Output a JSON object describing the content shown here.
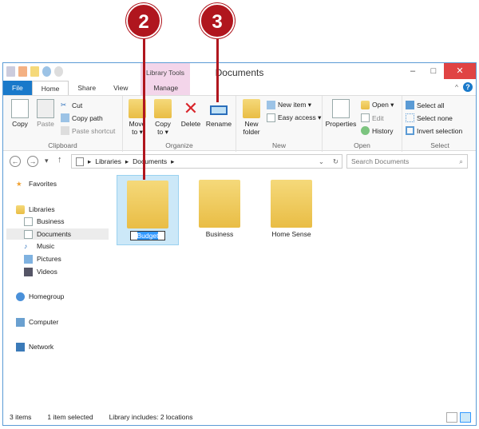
{
  "callouts": [
    "2",
    "3"
  ],
  "title": {
    "window_title": "Documents",
    "contextual_tab": "Library Tools"
  },
  "tabs": [
    "File",
    "Home",
    "Share",
    "View",
    "Manage"
  ],
  "ribbon": {
    "clipboard": {
      "label": "Clipboard",
      "copy": "Copy",
      "paste": "Paste",
      "cut": "Cut",
      "copy_path": "Copy path",
      "paste_shortcut": "Paste shortcut"
    },
    "organize": {
      "label": "Organize",
      "move_to": "Move to ▾",
      "copy_to": "Copy to ▾",
      "delete": "Delete",
      "rename": "Rename"
    },
    "new": {
      "label": "New",
      "new_folder": "New folder",
      "new_item": "New item ▾",
      "easy_access": "Easy access ▾"
    },
    "open": {
      "label": "Open",
      "properties": "Properties",
      "open": "Open ▾",
      "edit": "Edit",
      "history": "History"
    },
    "select": {
      "label": "Select",
      "select_all": "Select all",
      "select_none": "Select none",
      "invert": "Invert selection"
    }
  },
  "address": {
    "crumbs": [
      "Libraries",
      "Documents"
    ],
    "search_placeholder": "Search Documents"
  },
  "sidebar": {
    "favorites": "Favorites",
    "libraries": "Libraries",
    "library_items": [
      "Business",
      "Documents",
      "Music",
      "Pictures",
      "Videos"
    ],
    "homegroup": "Homegroup",
    "computer": "Computer",
    "network": "Network"
  },
  "files": [
    {
      "name": "Budget"
    },
    {
      "name": "Business"
    },
    {
      "name": "Home Sense"
    }
  ],
  "status": {
    "count": "3 items",
    "selected": "1 item selected",
    "library": "Library includes: 2 locations"
  }
}
